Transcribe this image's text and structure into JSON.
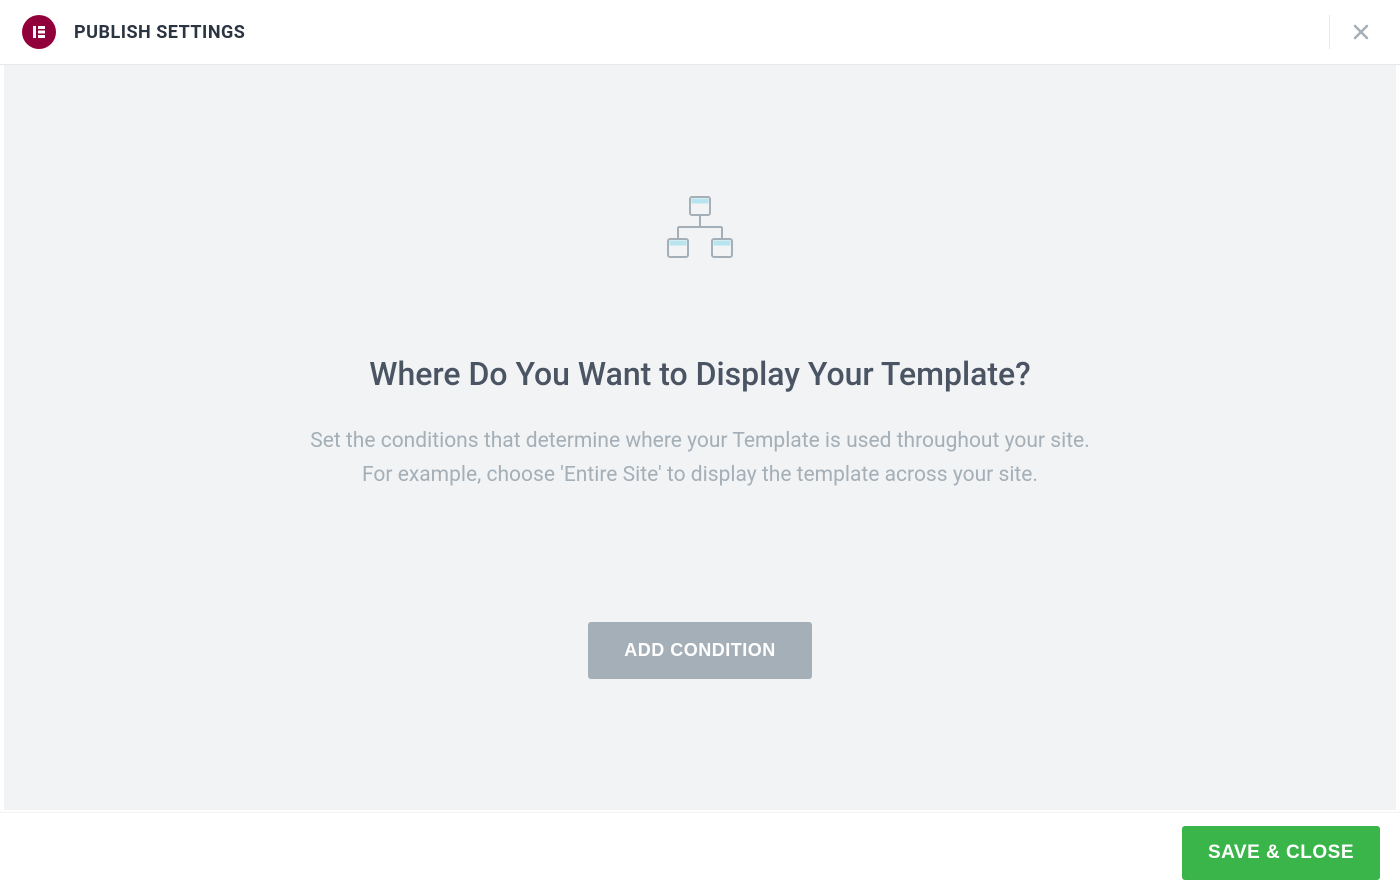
{
  "header": {
    "title": "PUBLISH SETTINGS"
  },
  "main": {
    "heading": "Where Do You Want to Display Your Template?",
    "description_line1": "Set the conditions that determine where your Template is used throughout your site.",
    "description_line2": "For example, choose 'Entire Site' to display the template across your site.",
    "add_condition_label": "ADD CONDITION"
  },
  "footer": {
    "save_close_label": "SAVE & CLOSE"
  }
}
